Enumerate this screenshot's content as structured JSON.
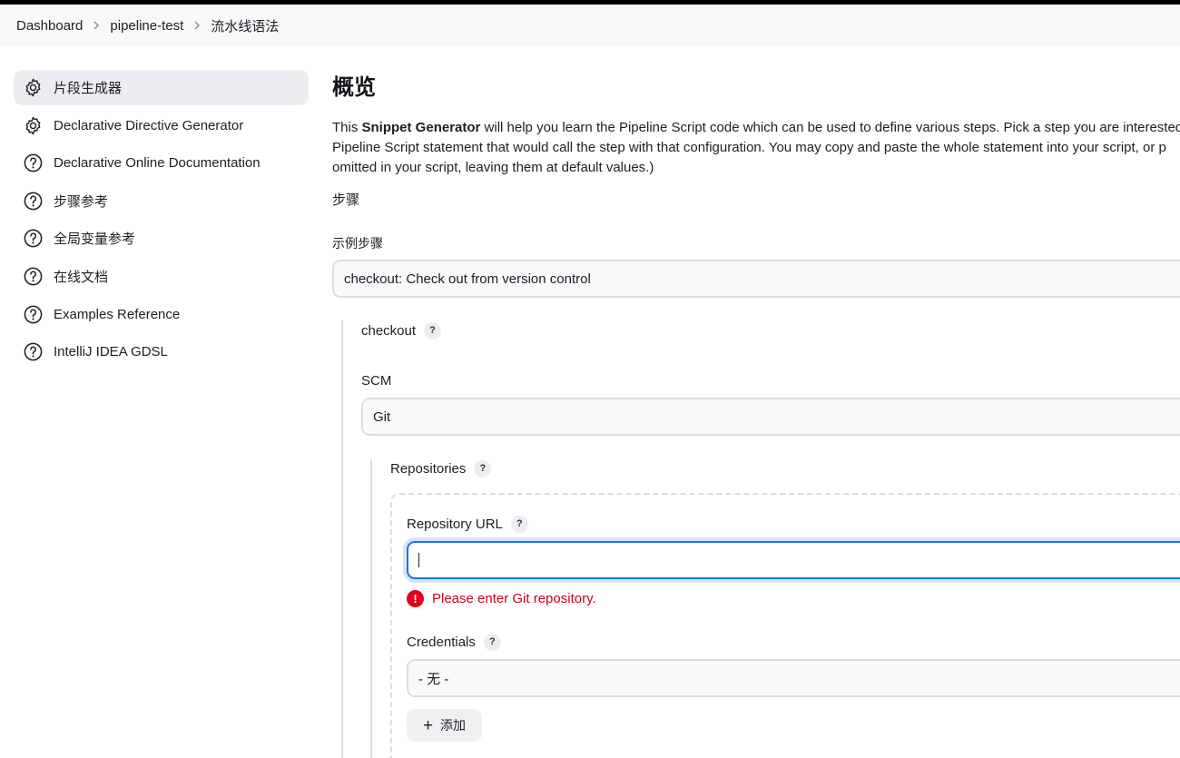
{
  "breadcrumb": {
    "items": [
      "Dashboard",
      "pipeline-test",
      "流水线语法"
    ]
  },
  "sidebar": {
    "items": [
      {
        "label": "片段生成器",
        "icon": "gear-icon",
        "active": true
      },
      {
        "label": "Declarative Directive Generator",
        "icon": "gear-icon"
      },
      {
        "label": "Declarative Online Documentation",
        "icon": "help-circle-icon"
      },
      {
        "label": "步骤参考",
        "icon": "help-circle-icon"
      },
      {
        "label": "全局变量参考",
        "icon": "help-circle-icon"
      },
      {
        "label": "在线文档",
        "icon": "help-circle-icon"
      },
      {
        "label": "Examples Reference",
        "icon": "help-circle-icon"
      },
      {
        "label": "IntelliJ IDEA GDSL",
        "icon": "help-circle-icon"
      }
    ]
  },
  "main": {
    "title": "概览",
    "description": {
      "prefix": "This ",
      "bold": "Snippet Generator",
      "line1_rest": " will help you learn the Pipeline Script code which can be used to define various steps. Pick a step you are interested",
      "line2": "Pipeline Script statement that would call the step with that configuration. You may copy and paste the whole statement into your script, or p",
      "line3": "omitted in your script, leaving them at default values.)"
    },
    "steps_label": "步骤",
    "sample_step_label": "示例步骤",
    "sample_step_value": "checkout: Check out from version control",
    "checkout_label": "checkout",
    "scm_label": "SCM",
    "scm_value": "Git",
    "repositories_label": "Repositories",
    "repo_url_label": "Repository URL",
    "repo_url_value": "",
    "repo_url_error": "Please enter Git repository.",
    "credentials_label": "Credentials",
    "credentials_value": "- 无 -",
    "add_button": "添加",
    "help_glyph": "?"
  },
  "colors": {
    "accent": "#1a73e8",
    "error": "#e0001b"
  }
}
